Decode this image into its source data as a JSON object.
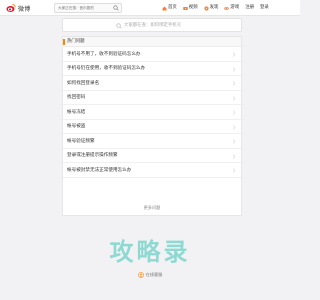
{
  "topbar": {
    "logo_text": "微博",
    "search_placeholder": "大家正在搜：音乐剧的",
    "nav": [
      {
        "icon": "home-icon",
        "label": "首页"
      },
      {
        "icon": "video-icon",
        "label": "视频"
      },
      {
        "icon": "discover-icon",
        "label": "发现"
      },
      {
        "icon": "game-icon",
        "label": "游戏"
      }
    ],
    "register": "注册",
    "login": "登录"
  },
  "help_search": {
    "placeholder": "大家都在查：如何绑定手机号"
  },
  "panel": {
    "title": "热门问题",
    "items": [
      "手机号不用了，收不到验证码怎么办",
      "手机号仍在使用，收不到验证码怎么办",
      "如何找回登录名",
      "找回密码",
      "帐号冻结",
      "帐号被盗",
      "帐号验证频繁",
      "登录或注册提示操作频繁",
      "帐号被封禁无法正常使用怎么办"
    ],
    "more_label": "更多问题"
  },
  "watermark": "攻略录",
  "footer": {
    "label": "在线客服"
  },
  "colors": {
    "accent": "#ff8200",
    "watermark": "#3ec6b5"
  }
}
